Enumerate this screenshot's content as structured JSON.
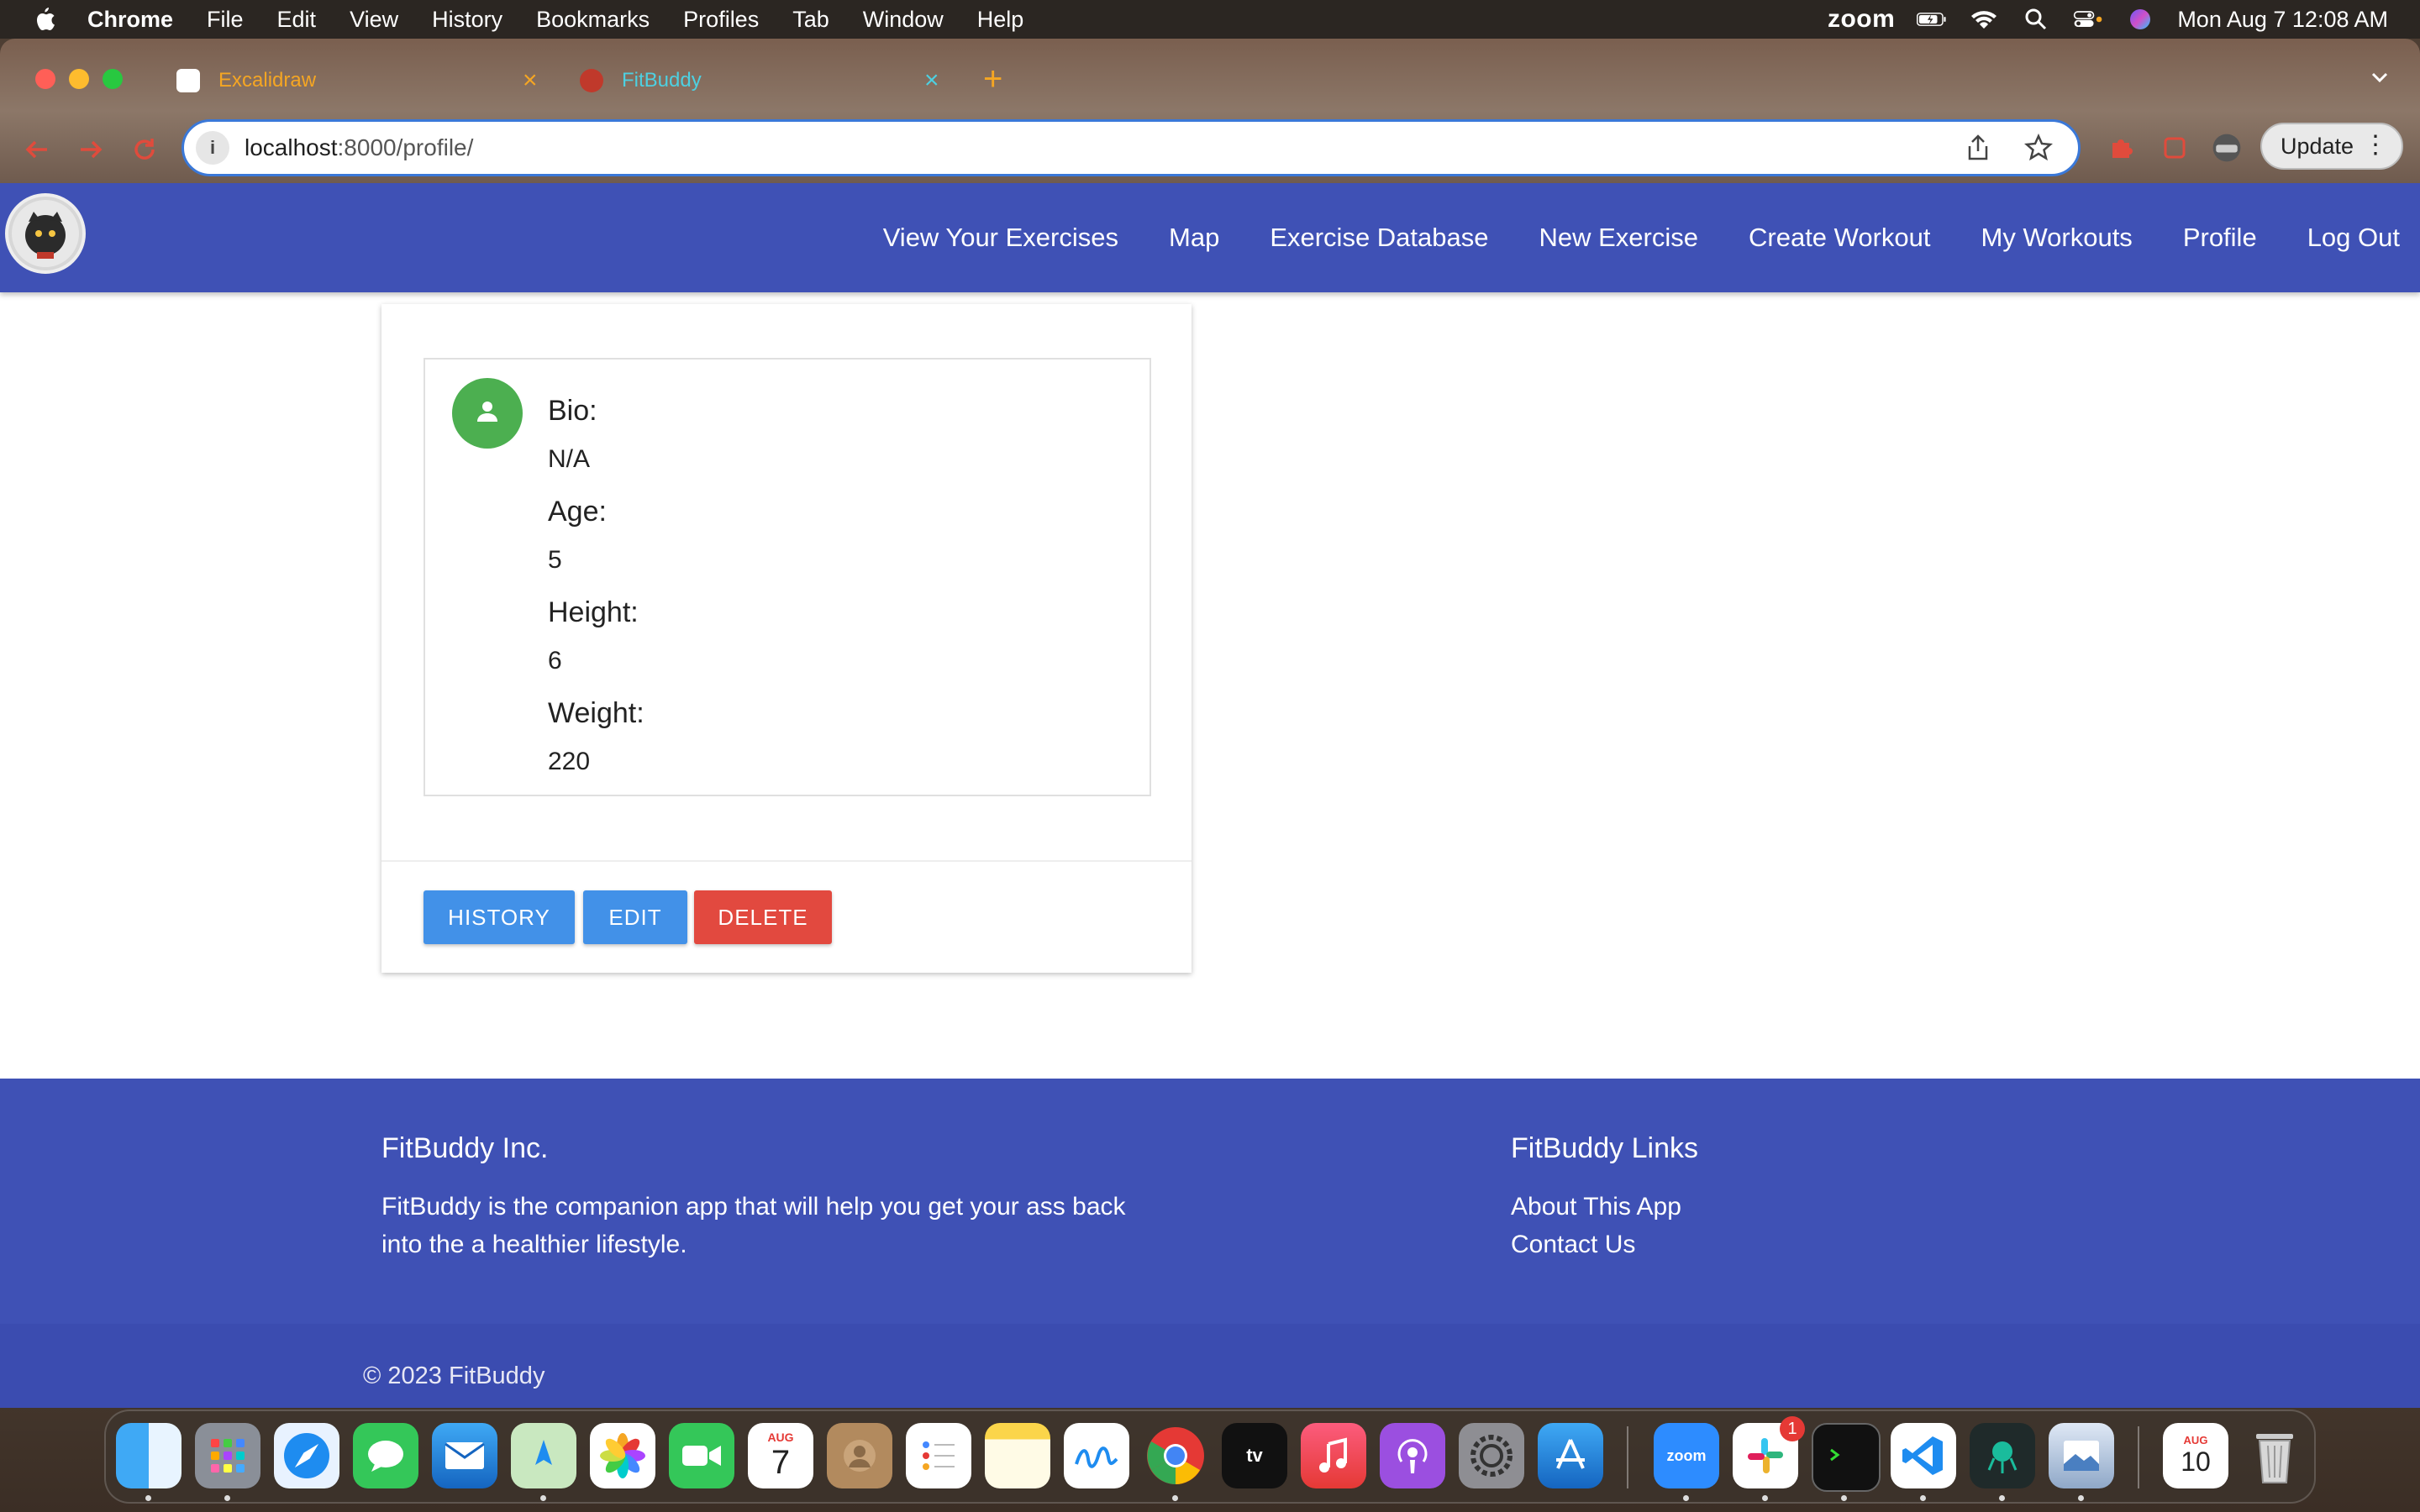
{
  "menubar": {
    "app_name": "Chrome",
    "items": [
      "File",
      "Edit",
      "View",
      "History",
      "Bookmarks",
      "Profiles",
      "Tab",
      "Window",
      "Help"
    ],
    "zoom": "zoom",
    "datetime": "Mon Aug 7  12:08 AM"
  },
  "browser": {
    "tabs": [
      {
        "title": "Excalidraw",
        "active": false,
        "color": "#f5a623"
      },
      {
        "title": "FitBuddy",
        "active": true,
        "color": "#4dd0e1"
      }
    ],
    "url_host": "localhost",
    "url_rest": ":8000/profile/",
    "update_label": "Update"
  },
  "nav": {
    "links": [
      "View Your Exercises",
      "Map",
      "Exercise Database",
      "New Exercise",
      "Create Workout",
      "My Workouts",
      "Profile",
      "Log Out"
    ],
    "bg_color": "#3f51b5"
  },
  "profile": {
    "bio_label": "Bio:",
    "bio_value": "N/A",
    "age_label": "Age:",
    "age_value": "5",
    "height_label": "Height:",
    "height_value": "6",
    "weight_label": "Weight:",
    "weight_value": "220"
  },
  "actions": {
    "history": "HISTORY",
    "edit": "EDIT",
    "delete": "DELETE"
  },
  "footer": {
    "company_title": "FitBuddy Inc.",
    "company_text_line1": "FitBuddy is the companion app that will help you get your ass back",
    "company_text_line2": "into the a healthier lifestyle.",
    "links_title": "FitBuddy Links",
    "link_about": "About This App",
    "link_contact": "Contact Us",
    "copyright": "© 2023 FitBuddy"
  },
  "dock": {
    "apps": [
      "Finder",
      "Launchpad",
      "Safari",
      "Messages",
      "Mail",
      "Maps",
      "Photos",
      "FaceTime",
      "Calendar",
      "Contacts",
      "Reminders",
      "Notes",
      "Freeform",
      "Chrome",
      "TV",
      "Music",
      "Podcasts",
      "System Settings",
      "App Store",
      "Zoom",
      "Slack",
      "Terminal",
      "VS Code",
      "GitKraken",
      "Preview",
      "Calendar Widget",
      "Trash"
    ],
    "calendar_month": "AUG",
    "calendar_day": "7",
    "widget_month": "AUG",
    "widget_day": "10",
    "slack_badge": "1",
    "zoom_label": "zoom",
    "tv_label": "tv"
  }
}
